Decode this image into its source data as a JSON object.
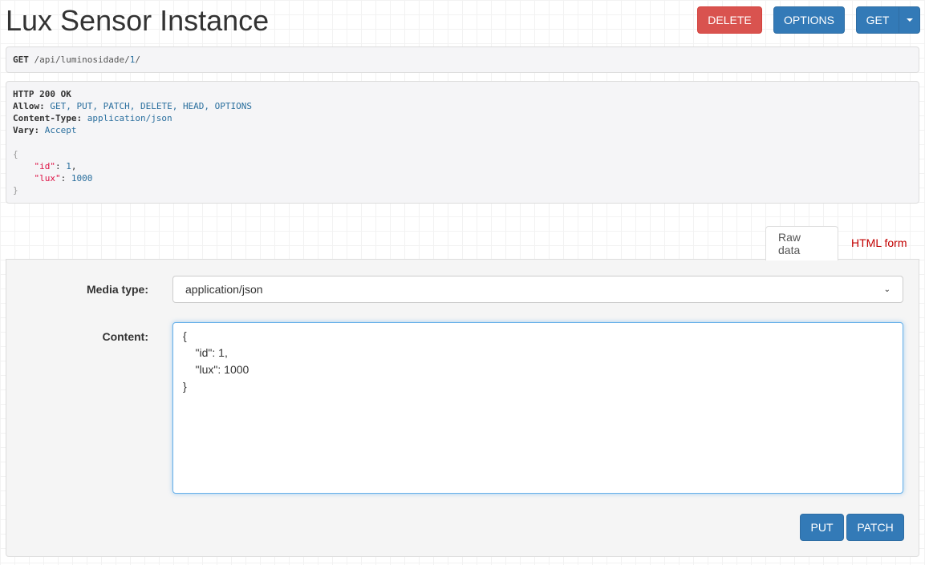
{
  "page": {
    "title": "Lux Sensor Instance"
  },
  "toolbar": {
    "delete": "DELETE",
    "options": "OPTIONS",
    "get": "GET"
  },
  "request": {
    "method": "GET",
    "path_prefix": "/api/luminosidade/",
    "path_id": "1",
    "path_suffix": "/"
  },
  "response": {
    "status": "HTTP 200 OK",
    "headers": [
      {
        "name": "Allow:",
        "value": "GET, PUT, PATCH, DELETE, HEAD, OPTIONS"
      },
      {
        "name": "Content-Type:",
        "value": "application/json"
      },
      {
        "name": "Vary:",
        "value": "Accept"
      }
    ],
    "open": "{",
    "close": "}",
    "fields": [
      {
        "key": "\"id\"",
        "value": "1",
        "sep": ","
      },
      {
        "key": "\"lux\"",
        "value": "1000",
        "sep": ""
      }
    ]
  },
  "tabs": [
    {
      "label": "Raw data",
      "active": true
    },
    {
      "label": "HTML form",
      "active": false
    }
  ],
  "form": {
    "media_label": "Media type:",
    "media_value": "application/json",
    "content_label": "Content:",
    "content_value": "{\n    \"id\": 1,\n    \"lux\": 1000\n}",
    "put": "PUT",
    "patch": "PATCH"
  }
}
